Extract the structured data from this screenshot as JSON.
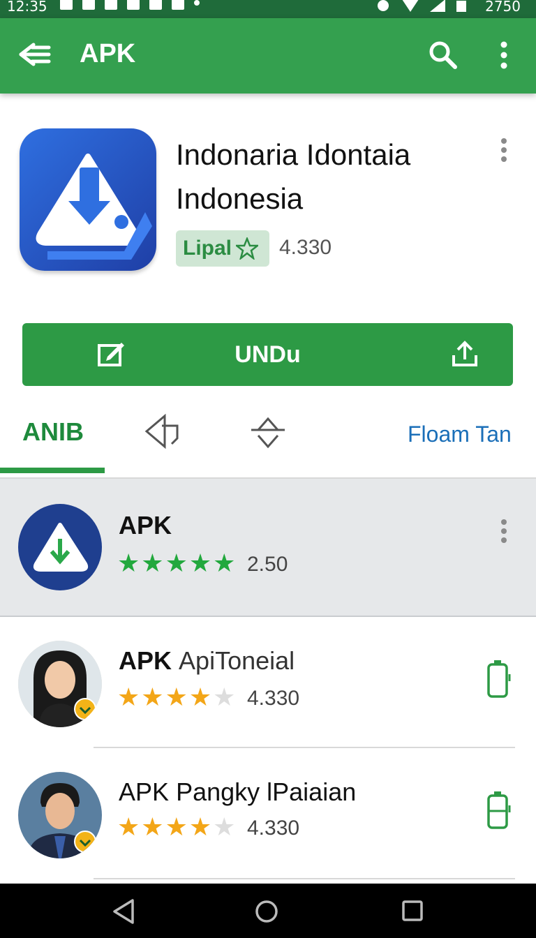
{
  "status_bar": {
    "time": "12:35",
    "battery": "2750"
  },
  "app_bar": {
    "title": "APK",
    "menu_icon": "hamburger-icon",
    "search_icon": "search-icon",
    "more_icon": "more-vert-icon"
  },
  "app": {
    "name": "Indonaria Idontaia Indonesia",
    "badge_label": "Lipal",
    "rating": "4.330",
    "install_label": "UNDu"
  },
  "tabs": [
    {
      "label": "ANIB",
      "active": true
    },
    {
      "icon": "back-arrow-tab-icon"
    },
    {
      "icon": "swap-arrows-tab-icon"
    },
    {
      "label": "Floam Tan"
    }
  ],
  "list": [
    {
      "title": "APK",
      "subtitle": "",
      "rating": "2.50",
      "stars": 5,
      "star_color": "#22a83d"
    },
    {
      "title": "APK",
      "subtitle": "ApiToneial",
      "rating": "4.330",
      "stars": 4,
      "star_color": "#f3a618"
    },
    {
      "title": "APK",
      "subtitle": "Pangky lPaiaian",
      "rating": "4.330",
      "stars": 4,
      "star_color": "#f3a618"
    }
  ],
  "colors": {
    "accent": "#34a04f",
    "status_bar": "#1f6b3a",
    "link": "#1b6fb8"
  }
}
